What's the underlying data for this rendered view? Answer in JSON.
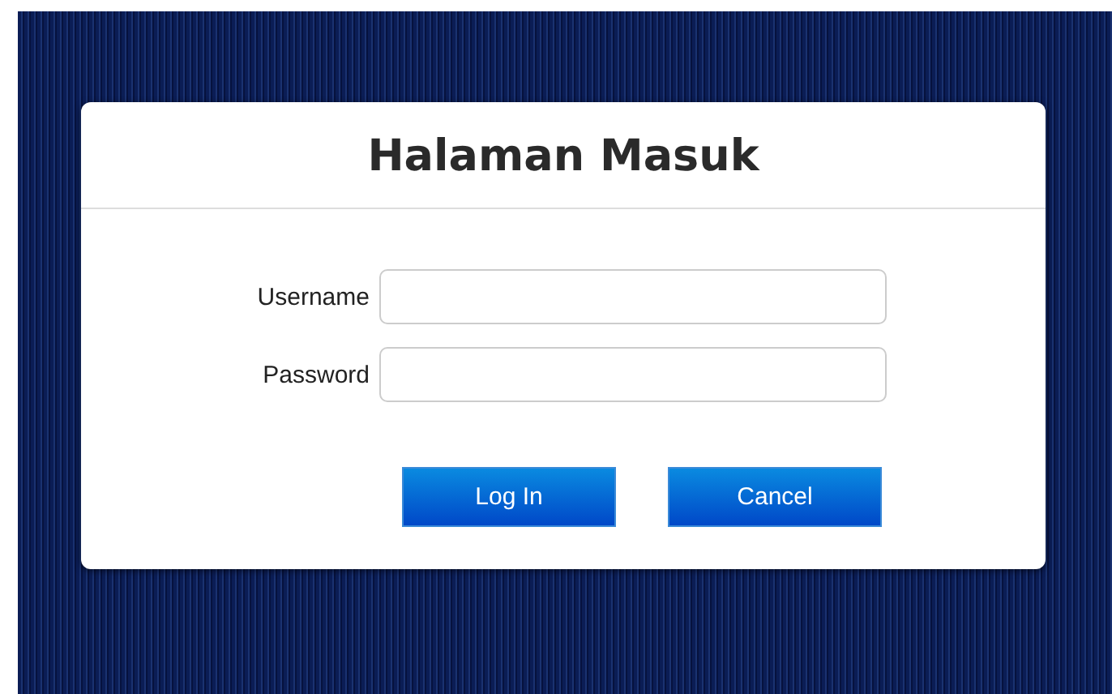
{
  "login_card": {
    "title": "Halaman Masuk",
    "fields": [
      {
        "label": "Username"
      },
      {
        "label": "Password"
      }
    ],
    "buttons": [
      "Log In",
      "Cancel"
    ]
  }
}
